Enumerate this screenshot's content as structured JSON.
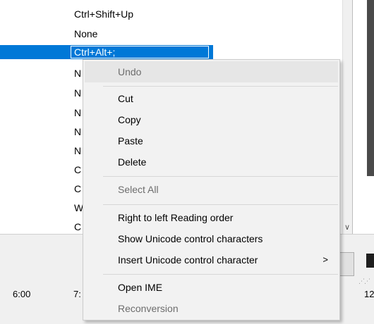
{
  "list": {
    "items": [
      {
        "label": "Ctrl+Shift+Up"
      },
      {
        "label": "None"
      },
      {
        "label": "Ctrl+Alt+;"
      },
      {
        "label": "N"
      },
      {
        "label": "N"
      },
      {
        "label": "N"
      },
      {
        "label": "N"
      },
      {
        "label": "N"
      },
      {
        "label": "C"
      },
      {
        "label": "C"
      },
      {
        "label": "W"
      },
      {
        "label": "C"
      }
    ]
  },
  "ruler": {
    "labels": [
      "6:00",
      "7:",
      "12"
    ]
  },
  "context_menu": {
    "undo": "Undo",
    "cut": "Cut",
    "copy": "Copy",
    "paste": "Paste",
    "delete": "Delete",
    "select_all": "Select All",
    "rtl_reading": "Right to left Reading order",
    "show_unicode": "Show Unicode control characters",
    "insert_unicode": "Insert Unicode control character",
    "submenu_arrow": ">",
    "open_ime": "Open IME",
    "reconversion": "Reconversion"
  },
  "colors": {
    "selection": "#0078d7",
    "menu_bg": "#f2f2f2",
    "disabled_text": "#6d6d6d"
  }
}
